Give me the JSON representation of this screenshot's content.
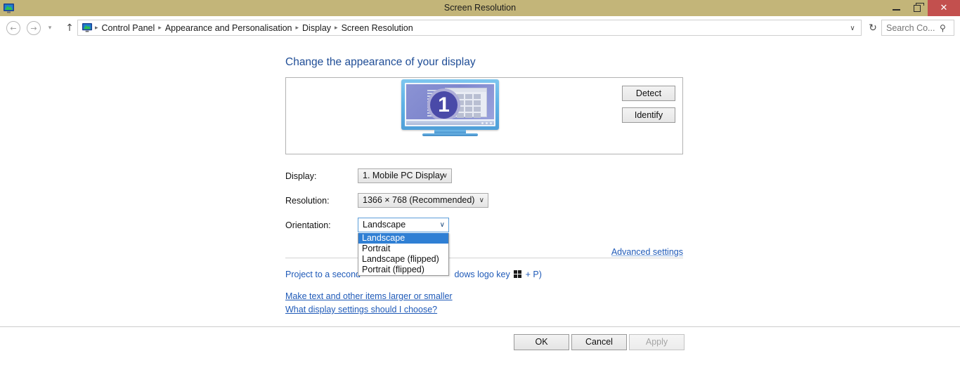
{
  "window": {
    "title": "Screen Resolution",
    "icon": "display-icon",
    "minimize_label": "–",
    "maximize_label": "❐",
    "close_label": "✕"
  },
  "addressbar": {
    "back_label": "←",
    "forward_label": "→",
    "recent_label": "▾",
    "up_label": "↑",
    "breadcrumb": [
      "Control Panel",
      "Appearance and Personalisation",
      "Display",
      "Screen Resolution"
    ],
    "separator": "▸",
    "dropdown_label": "∨",
    "refresh_label": "↻",
    "search_value": "",
    "search_placeholder": "Search Co...",
    "search_icon": "⚲"
  },
  "main": {
    "page_title": "Change the appearance of your display",
    "preview": {
      "monitor_number": "1"
    },
    "buttons": {
      "detect": "Detect",
      "identify": "Identify"
    },
    "fields": {
      "display_label": "Display:",
      "display_value": "1. Mobile PC Display",
      "resolution_label": "Resolution:",
      "resolution_value": "1366 × 768 (Recommended)",
      "orientation_label": "Orientation:",
      "orientation_value": "Landscape",
      "arrow": "∨"
    },
    "orientation_options": [
      {
        "label": "Landscape",
        "selected": true
      },
      {
        "label": "Portrait",
        "selected": false
      },
      {
        "label": "Landscape (flipped)",
        "selected": false
      },
      {
        "label": "Portrait (flipped)",
        "selected": false
      }
    ],
    "links": {
      "advanced_settings": "Advanced settings",
      "project_prefix": "Project to a second ",
      "project_suffix": "dows logo key ",
      "project_keysuffix": " + P)",
      "text_size": "Make text and other items larger or smaller",
      "what_settings": "What display settings should I choose?"
    }
  },
  "footer": {
    "ok": "OK",
    "cancel": "Cancel",
    "apply": "Apply"
  },
  "colors": {
    "titlebar": "#c3b579",
    "close_button": "#c3504e",
    "link": "#1f5ab8",
    "heading": "#1f4d96",
    "highlight": "#2f7fd4"
  }
}
